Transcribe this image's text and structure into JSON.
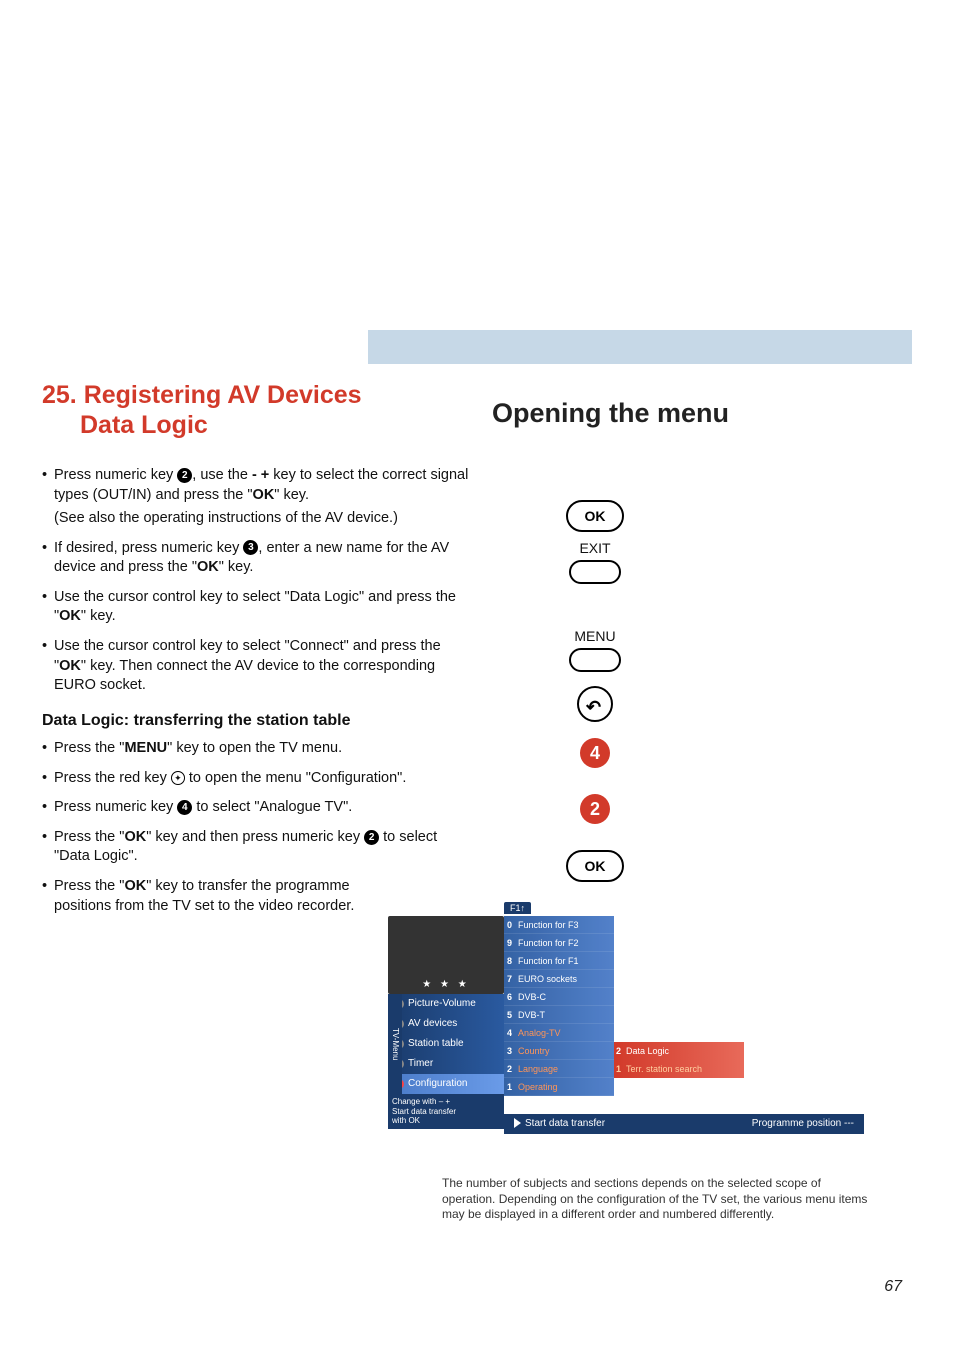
{
  "title": {
    "left_line1": "25. Registering AV Devices",
    "left_line2": "Data Logic",
    "right": "Opening the menu"
  },
  "bullets": {
    "b1_a": "Press numeric key ",
    "b1_num": "2",
    "b1_b": ", use the ",
    "b1_keys": "- +",
    "b1_c": " key to select the correct signal types (OUT/IN) and press the \"",
    "b1_ok": "OK",
    "b1_d": "\" key.",
    "b1_sub": "(See also the operating instructions of the AV device.)",
    "b2_a": "If desired, press numeric key ",
    "b2_num": "3",
    "b2_b": ", enter a new name for the AV device and press the \"",
    "b2_ok": "OK",
    "b2_c": "\" key.",
    "b3_a": "Use the cursor control key to select  \"Data Logic\" and press the \"",
    "b3_ok": "OK",
    "b3_b": "\" key.",
    "b4_a": "Use the cursor control key to select \"Connect\" and press the \"",
    "b4_ok": "OK",
    "b4_b": "\" key. Then connect the AV device to the corresponding EURO socket."
  },
  "subheading": "Data Logic: transferring the station table",
  "bullets2": {
    "b5_a": "Press the \"",
    "b5_menu": "MENU",
    "b5_b": "\" key to open the TV menu.",
    "b6_a": "Press the red key ",
    "b6_b": " to open the menu \"Configuration\".",
    "b7_a": "Press numeric key ",
    "b7_num": "4",
    "b7_b": " to select \"Analogue TV\".",
    "b8_a": "Press the \"",
    "b8_ok": "OK",
    "b8_b": "\" key and then press numeric key ",
    "b8_num": "2",
    "b8_c": " to select \"Data Logic\".",
    "b9_a": "Press the \"",
    "b9_ok": "OK",
    "b9_b": "\" key to transfer the programme positions from the TV set to the video recorder."
  },
  "remote": {
    "ok": "OK",
    "exit": "EXIT",
    "menu": "MENU",
    "n4": "4",
    "n2": "2"
  },
  "osd": {
    "tab": "F1↑",
    "stars": "★ ★ ★",
    "vstrip": "TV-Menu",
    "left": [
      "Picture-Volume",
      "AV devices",
      "Station table",
      "Timer",
      "Configuration"
    ],
    "hint_l1": "Change with – +",
    "hint_l2": "Start data transfer",
    "hint_l3": "with OK",
    "mid": [
      {
        "n": "0",
        "t": "Function for F3"
      },
      {
        "n": "9",
        "t": "Function for F2"
      },
      {
        "n": "8",
        "t": "Function for F1"
      },
      {
        "n": "7",
        "t": "EURO sockets"
      },
      {
        "n": "6",
        "t": "DVB-C"
      },
      {
        "n": "5",
        "t": "DVB-T"
      },
      {
        "n": "4",
        "t": "Analog-TV"
      },
      {
        "n": "3",
        "t": "Country"
      },
      {
        "n": "2",
        "t": "Language"
      },
      {
        "n": "1",
        "t": "Operating"
      }
    ],
    "right": [
      {
        "n": "2",
        "t": "Data Logic"
      },
      {
        "n": "1",
        "t": "Terr. station search"
      }
    ],
    "status_l": "Start data transfer",
    "status_r": "Programme position ---"
  },
  "footnote": "The number of subjects and sections depends on the selected scope of operation. Depending on the configuration of the TV set, the various menu items may be displayed in a different order and numbered differently.",
  "pagenum": "67"
}
